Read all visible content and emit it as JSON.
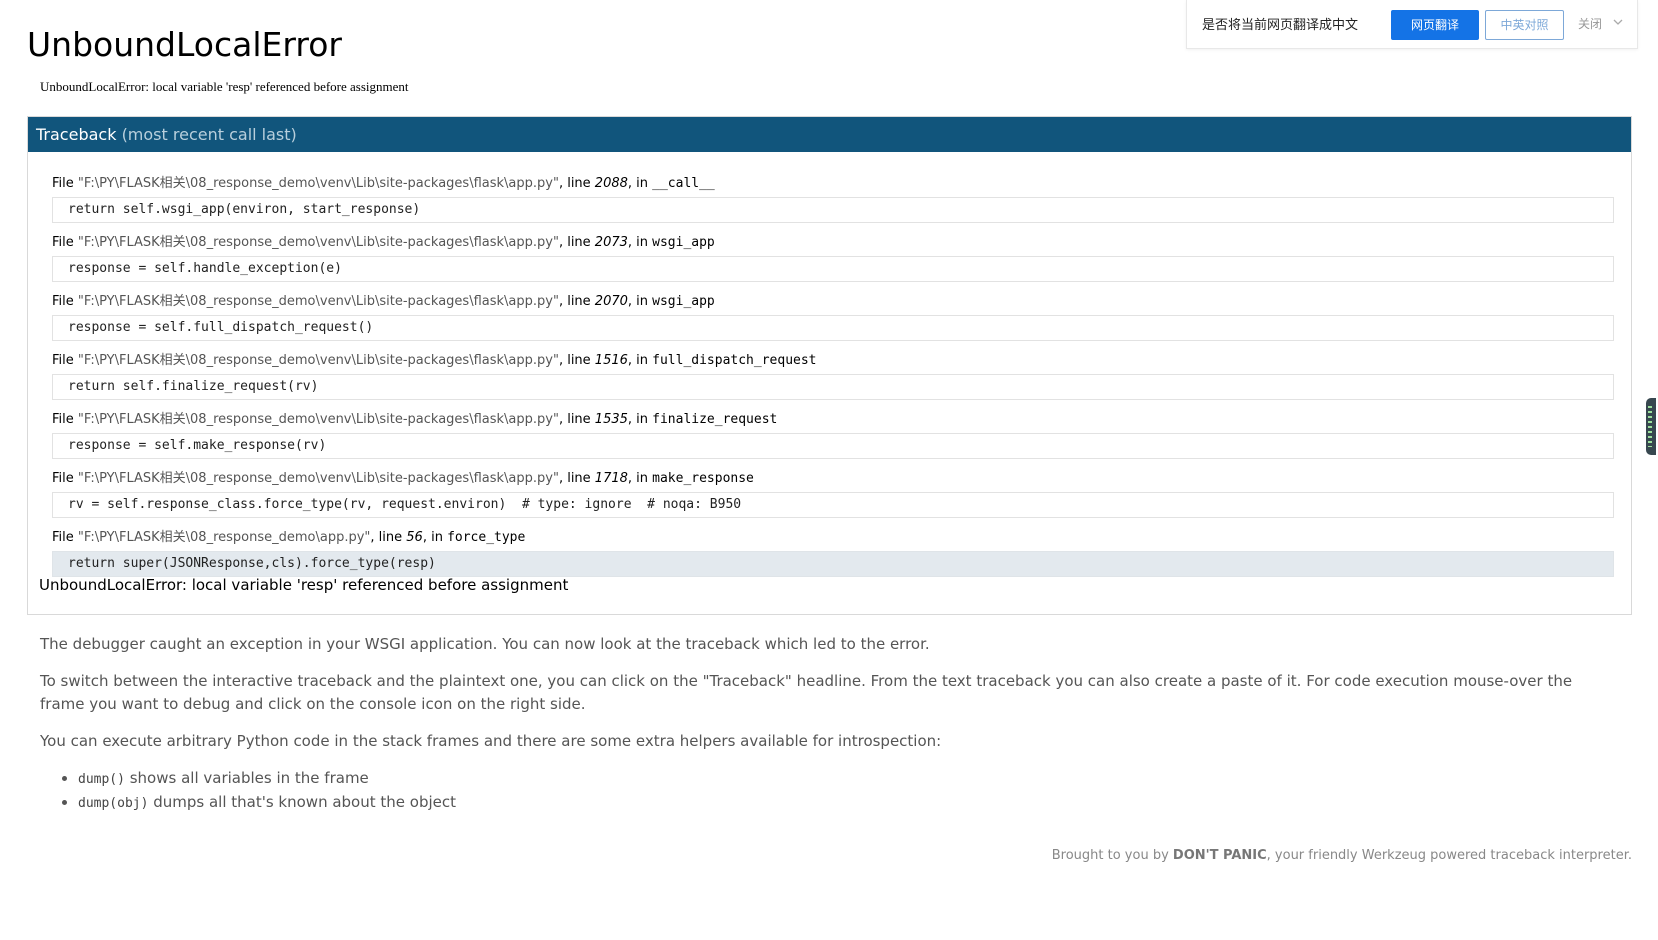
{
  "title": "UnboundLocalError",
  "error_message": "UnboundLocalError: local variable 'resp' referenced before assignment",
  "traceback": {
    "header_label": "Traceback",
    "header_sub": "(most recent call last)",
    "frames": [
      {
        "file_prefix": "File ",
        "path": "\"F:\\PY\\FLASK相关\\08_response_demo\\venv\\Lib\\site-packages\\flask\\app.py\"",
        "line_label": ", line ",
        "lineno": "2088",
        "in_label": ", in ",
        "func": "__call__",
        "code": "return self.wsgi_app(environ, start_response)"
      },
      {
        "file_prefix": "File ",
        "path": "\"F:\\PY\\FLASK相关\\08_response_demo\\venv\\Lib\\site-packages\\flask\\app.py\"",
        "line_label": ", line ",
        "lineno": "2073",
        "in_label": ", in ",
        "func": "wsgi_app",
        "code": "response = self.handle_exception(e)"
      },
      {
        "file_prefix": "File ",
        "path": "\"F:\\PY\\FLASK相关\\08_response_demo\\venv\\Lib\\site-packages\\flask\\app.py\"",
        "line_label": ", line ",
        "lineno": "2070",
        "in_label": ", in ",
        "func": "wsgi_app",
        "code": "response = self.full_dispatch_request()"
      },
      {
        "file_prefix": "File ",
        "path": "\"F:\\PY\\FLASK相关\\08_response_demo\\venv\\Lib\\site-packages\\flask\\app.py\"",
        "line_label": ", line ",
        "lineno": "1516",
        "in_label": ", in ",
        "func": "full_dispatch_request",
        "code": "return self.finalize_request(rv)"
      },
      {
        "file_prefix": "File ",
        "path": "\"F:\\PY\\FLASK相关\\08_response_demo\\venv\\Lib\\site-packages\\flask\\app.py\"",
        "line_label": ", line ",
        "lineno": "1535",
        "in_label": ", in ",
        "func": "finalize_request",
        "code": "response = self.make_response(rv)"
      },
      {
        "file_prefix": "File ",
        "path": "\"F:\\PY\\FLASK相关\\08_response_demo\\venv\\Lib\\site-packages\\flask\\app.py\"",
        "line_label": ", line ",
        "lineno": "1718",
        "in_label": ", in ",
        "func": "make_response",
        "code": "rv = self.response_class.force_type(rv, request.environ)  # type: ignore  # noqa: B950"
      },
      {
        "file_prefix": "File ",
        "path": "\"F:\\PY\\FLASK相关\\08_response_demo\\app.py\"",
        "line_label": ", line ",
        "lineno": "56",
        "in_label": ", in ",
        "func": "force_type",
        "code": "return super(JSONResponse,cls).force_type(resp)"
      }
    ],
    "final_error": "UnboundLocalError: local variable 'resp' referenced before assignment"
  },
  "explanation": {
    "p1": "The debugger caught an exception in your WSGI application. You can now look at the traceback which led to the error.",
    "p2": "To switch between the interactive traceback and the plaintext one, you can click on the \"Traceback\" headline. From the text traceback you can also create a paste of it. For code execution mouse-over the frame you want to debug and click on the console icon on the right side.",
    "p3": "You can execute arbitrary Python code in the stack frames and there are some extra helpers available for introspection:",
    "helpers": [
      {
        "code": "dump()",
        "text": " shows all variables in the frame"
      },
      {
        "code": "dump(obj)",
        "text": " dumps all that's known about the object"
      }
    ]
  },
  "footer": {
    "prefix": "Brought to you by ",
    "brand": "DON'T PANIC",
    "suffix": ", your friendly Werkzeug powered traceback interpreter."
  },
  "translate_bar": {
    "prompt": "是否将当前网页翻译成中文",
    "translate_button": "网页翻译",
    "bilingual_button": "中英对照",
    "close_label": "关闭",
    "icon": "chevron-down-icon"
  },
  "colors": {
    "header_bg": "#11557c",
    "translate_blue": "#1473e6",
    "current_frame_bg": "#e3e9ee"
  }
}
